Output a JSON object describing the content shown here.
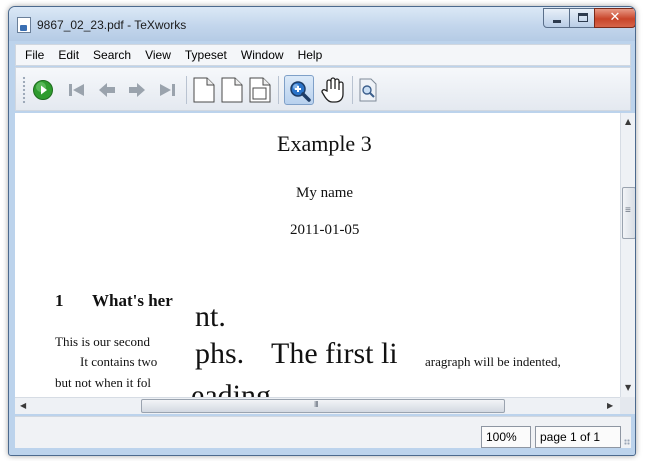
{
  "window": {
    "title": "9867_02_23.pdf - TeXworks"
  },
  "menu": [
    "File",
    "Edit",
    "Search",
    "View",
    "Typeset",
    "Window",
    "Help"
  ],
  "toolbar_icons": [
    "typeset-play-icon",
    "first-page-icon",
    "previous-page-icon",
    "next-page-icon",
    "last-page-icon",
    "actual-size-icon",
    "fit-width-icon",
    "fit-window-icon",
    "magnify-icon",
    "scroll-hand-icon",
    "find-icon"
  ],
  "colors": {
    "typeset_green": "#2e9b2e",
    "close_red": "#c8452a"
  },
  "document": {
    "title": "Example 3",
    "author": "My name",
    "date": "2011-01-05",
    "section_number": "1",
    "section_title": "What's her",
    "para1_start": "This is our second",
    "para2_start": "It contains two",
    "para2_end": "aragraph will be indented,",
    "para3_start": "but not when it fol",
    "magnified_line1": "nt.",
    "magnified_line2_a": "phs.",
    "magnified_line2_b": "The first li",
    "magnified_line3": "eading."
  },
  "status": {
    "zoom": "100%",
    "page": "page 1 of 1"
  }
}
